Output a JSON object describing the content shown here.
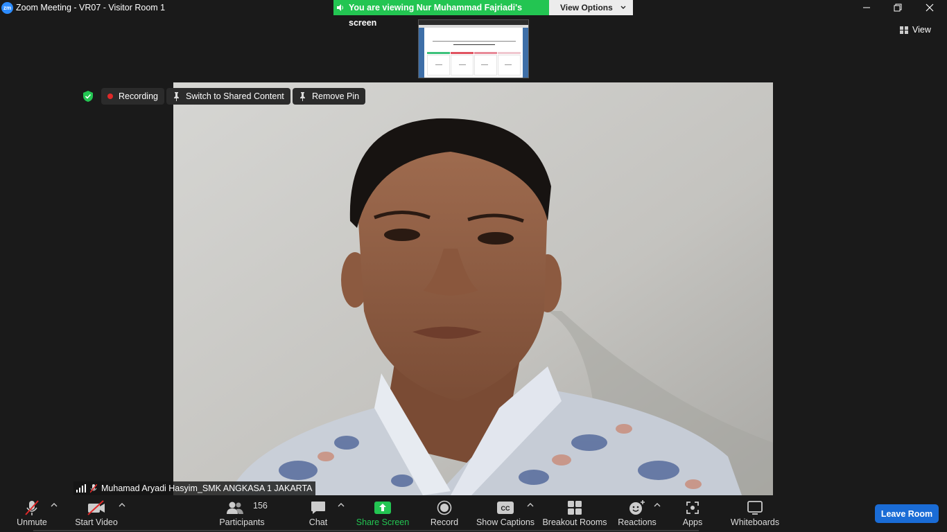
{
  "window": {
    "app_logo": "zm",
    "title": "Zoom Meeting - VR07 - Visitor Room 1",
    "controls": [
      "minimize-icon",
      "restore-icon",
      "close-icon"
    ]
  },
  "share_banner": {
    "text": "You are viewing Nur Muhammad Fajriadi's screen",
    "view_options_label": "View Options",
    "color": "#23c552"
  },
  "top_right": {
    "view_label": "View"
  },
  "pills": {
    "recording_label": "Recording",
    "switch_label": "Switch to Shared Content",
    "remove_pin_label": "Remove Pin"
  },
  "participant": {
    "name": "Muhamad Aryadi Hasyim_SMK ANGKASA 1 JAKARTA",
    "muted": true
  },
  "toolbar": {
    "unmute": "Unmute",
    "start_video": "Start Video",
    "participants": "Participants",
    "participants_count": "156",
    "chat": "Chat",
    "share_screen": "Share Screen",
    "record": "Record",
    "show_captions": "Show Captions",
    "breakout_rooms": "Breakout Rooms",
    "reactions": "Reactions",
    "apps": "Apps",
    "whiteboards": "Whiteboards",
    "leave_room": "Leave Room",
    "leave_color": "#1a6cd6",
    "share_color": "#23c552"
  }
}
